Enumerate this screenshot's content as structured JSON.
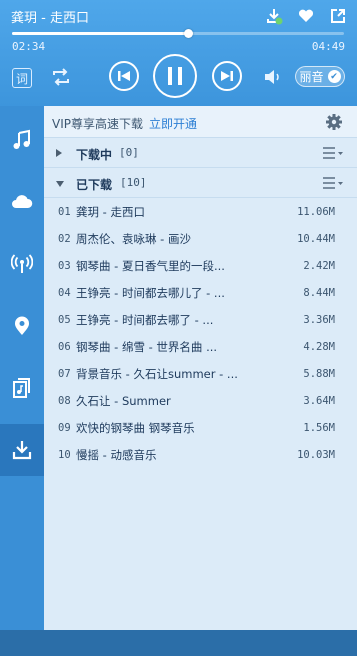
{
  "player": {
    "song_title": "龚玥 - 走西口",
    "current_time": "02:34",
    "duration": "04:49",
    "progress": 0.53,
    "lyrics_label": "词",
    "quality_label": "丽音",
    "quality_check": "✔"
  },
  "top_icons": [
    "download-icon",
    "heart-icon",
    "share-icon"
  ],
  "sidebar": {
    "items": [
      "music-note-icon",
      "cloud-icon",
      "radio-icon",
      "location-pin-icon",
      "playlist-icon",
      "download-tray-icon"
    ],
    "active_index": 5
  },
  "main": {
    "vip_text": "VIP尊享高速下载",
    "vip_link": "立即开通",
    "downloading": {
      "label": "下载中",
      "count": "[0]"
    },
    "downloaded": {
      "label": "已下载",
      "count": "[10]"
    },
    "songs": [
      {
        "num": "01",
        "name": "龚玥 - 走西口",
        "size": "11.06M"
      },
      {
        "num": "02",
        "name": "周杰伦、袁咏琳 - 画沙",
        "size": "10.44M"
      },
      {
        "num": "03",
        "name": "钢琴曲 - 夏日香气里的一段...",
        "size": "2.42M"
      },
      {
        "num": "04",
        "name": "王铮亮 - 时间都去哪儿了 - ...",
        "size": "8.44M"
      },
      {
        "num": "05",
        "name": "王铮亮 - 时间都去哪了 - ...",
        "size": "3.36M"
      },
      {
        "num": "06",
        "name": "钢琴曲 - 绵雪 - 世界名曲 ...",
        "size": "4.28M"
      },
      {
        "num": "07",
        "name": "背景音乐 - 久石让summer - ...",
        "size": "5.88M"
      },
      {
        "num": "08",
        "name": "久石让 - Summer",
        "size": "3.64M"
      },
      {
        "num": "09",
        "name": "欢快的钢琴曲 钢琴音乐",
        "size": "1.56M"
      },
      {
        "num": "10",
        "name": "慢摇 - 动感音乐",
        "size": "10.03M"
      }
    ]
  },
  "colors": {
    "accent": "#3a8fd6",
    "panel": "#dcebf8",
    "link": "#2c7fd4"
  }
}
